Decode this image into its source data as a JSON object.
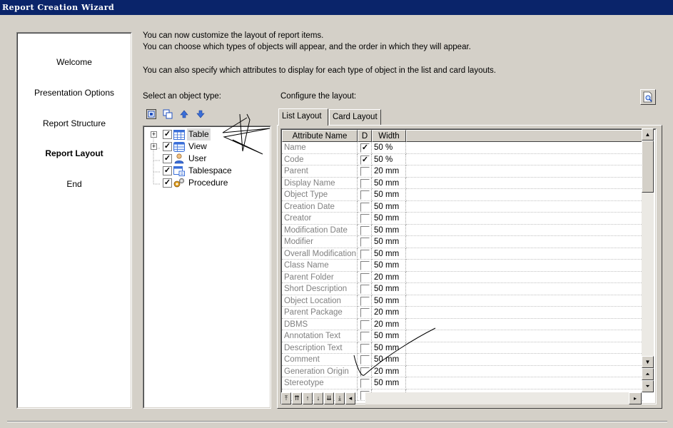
{
  "window": {
    "title": "Report Creation Wizard"
  },
  "steps": [
    {
      "label": "Welcome",
      "active": false
    },
    {
      "label": "Presentation Options",
      "active": false
    },
    {
      "label": "Report Structure",
      "active": false
    },
    {
      "label": "Report Layout",
      "active": true
    },
    {
      "label": "End",
      "active": false
    }
  ],
  "description": {
    "line1": "You can now customize the layout of report items.",
    "line2": "You can choose which types of objects will appear, and the order in which they will appear.",
    "line3": "You can also specify which attributes to display for each type of object in the list and card layouts."
  },
  "object_type": {
    "label": "Select an object type:",
    "toolbar": [
      "select-all-icon",
      "deselect-all-icon",
      "move-up-icon",
      "move-down-icon"
    ],
    "items": [
      {
        "label": "Table",
        "checked": true,
        "expandable": true,
        "icon": "table-icon",
        "selected": true
      },
      {
        "label": "View",
        "checked": true,
        "expandable": true,
        "icon": "view-icon",
        "selected": false
      },
      {
        "label": "User",
        "checked": true,
        "expandable": false,
        "icon": "user-icon",
        "selected": false
      },
      {
        "label": "Tablespace",
        "checked": true,
        "expandable": false,
        "icon": "tablespace-icon",
        "selected": false
      },
      {
        "label": "Procedure",
        "checked": true,
        "expandable": false,
        "icon": "procedure-icon",
        "selected": false
      }
    ]
  },
  "layout": {
    "label": "Configure the layout:",
    "tabs": [
      {
        "label": "List Layout",
        "active": true
      },
      {
        "label": "Card Layout",
        "active": false
      }
    ],
    "columns": {
      "name": "Attribute Name",
      "d": "D",
      "width": "Width"
    },
    "rows": [
      {
        "name": "Name",
        "d": true,
        "width": "50 %"
      },
      {
        "name": "Code",
        "d": true,
        "width": "50 %"
      },
      {
        "name": "Parent",
        "d": false,
        "width": "20 mm"
      },
      {
        "name": "Display Name",
        "d": false,
        "width": "50 mm"
      },
      {
        "name": "Object Type",
        "d": false,
        "width": "50 mm"
      },
      {
        "name": "Creation Date",
        "d": false,
        "width": "50 mm"
      },
      {
        "name": "Creator",
        "d": false,
        "width": "50 mm"
      },
      {
        "name": "Modification Date",
        "d": false,
        "width": "50 mm"
      },
      {
        "name": "Modifier",
        "d": false,
        "width": "50 mm"
      },
      {
        "name": "Overall Modification",
        "d": false,
        "width": "50 mm"
      },
      {
        "name": "Class Name",
        "d": false,
        "width": "50 mm"
      },
      {
        "name": "Parent Folder",
        "d": false,
        "width": "20 mm"
      },
      {
        "name": "Short Description",
        "d": false,
        "width": "50 mm"
      },
      {
        "name": "Object Location",
        "d": false,
        "width": "50 mm"
      },
      {
        "name": "Parent Package",
        "d": false,
        "width": "20 mm"
      },
      {
        "name": "DBMS",
        "d": false,
        "width": "20 mm"
      },
      {
        "name": "Annotation Text",
        "d": false,
        "width": "50 mm"
      },
      {
        "name": "Description Text",
        "d": false,
        "width": "50 mm"
      },
      {
        "name": "Comment",
        "d": false,
        "width": "50 mm"
      },
      {
        "name": "Generation Origin",
        "d": false,
        "width": "20 mm"
      },
      {
        "name": "Stereotype",
        "d": false,
        "width": "50 mm"
      },
      {
        "name": "",
        "d": false,
        "width": ""
      }
    ],
    "nav_buttons": [
      "move-top-icon",
      "move-up-page-icon",
      "move-up-icon",
      "move-down-icon",
      "move-down-page-icon",
      "move-bottom-icon"
    ],
    "preview_icon": "preview-icon"
  }
}
